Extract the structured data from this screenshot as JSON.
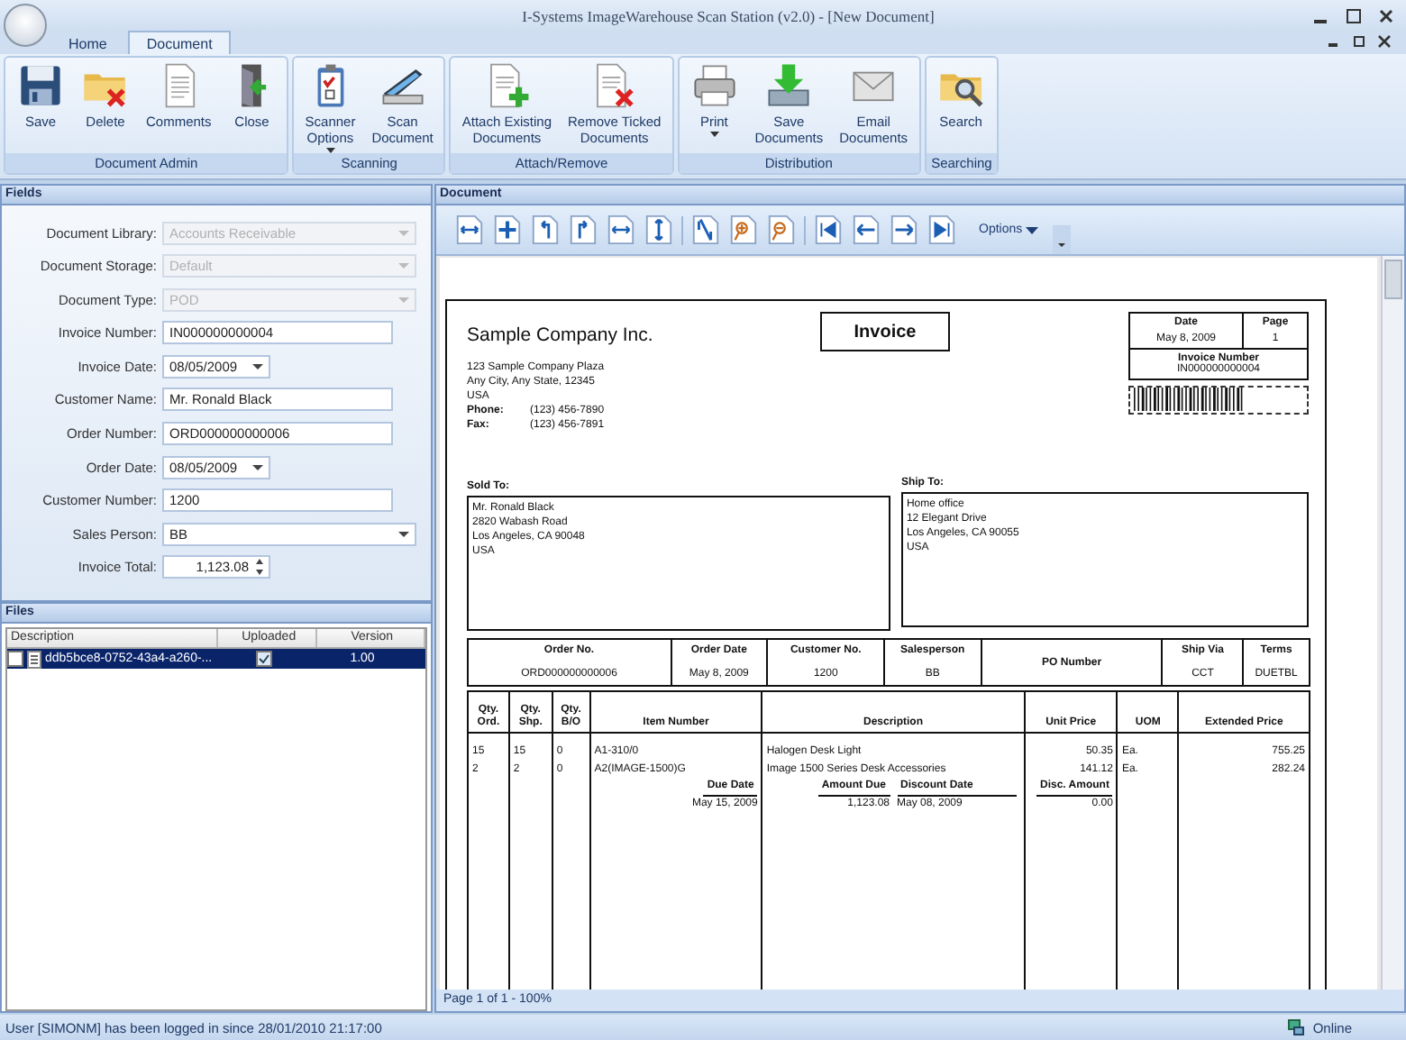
{
  "window": {
    "title": "I-Systems ImageWarehouse Scan Station (v2.0) - [New Document]"
  },
  "tabs": [
    {
      "label": "Home",
      "selected": false
    },
    {
      "label": "Document",
      "selected": true
    }
  ],
  "ribbon": [
    {
      "label": "Document Admin",
      "buttons": [
        {
          "kind": "floppy",
          "lines": [
            "Save"
          ]
        },
        {
          "kind": "folder-x",
          "lines": [
            "Delete"
          ]
        },
        {
          "kind": "page",
          "lines": [
            "Comments"
          ]
        },
        {
          "kind": "door",
          "lines": [
            "Close"
          ]
        }
      ]
    },
    {
      "label": "Scanning",
      "buttons": [
        {
          "kind": "clipboard",
          "lines": [
            "Scanner",
            "Options"
          ],
          "dropdown": true
        },
        {
          "kind": "scanner",
          "lines": [
            "Scan",
            "Document"
          ]
        }
      ]
    },
    {
      "label": "Attach/Remove",
      "buttons": [
        {
          "kind": "page-plus",
          "lines": [
            "Attach Existing",
            "Documents"
          ]
        },
        {
          "kind": "page-x",
          "lines": [
            "Remove Ticked",
            "Documents"
          ]
        }
      ]
    },
    {
      "label": "Distribution",
      "buttons": [
        {
          "kind": "printer",
          "lines": [
            "Print"
          ],
          "dropdown": true
        },
        {
          "kind": "tray",
          "lines": [
            "Save",
            "Documents"
          ]
        },
        {
          "kind": "envelope",
          "lines": [
            "Email",
            "Documents"
          ]
        }
      ]
    },
    {
      "label": "Searching",
      "buttons": [
        {
          "kind": "folder-search",
          "lines": [
            "Search"
          ]
        }
      ]
    }
  ],
  "fields": {
    "title": "Fields",
    "items": [
      {
        "label": "Document Library:",
        "value": "Accounts Receivable",
        "kind": "combo",
        "disabled": true
      },
      {
        "label": "Document Storage:",
        "value": "Default",
        "kind": "combo",
        "disabled": true
      },
      {
        "label": "Document Type:",
        "value": "POD",
        "kind": "combo",
        "disabled": true
      },
      {
        "label": "Invoice Number:",
        "value": "IN000000000004",
        "kind": "text",
        "disabled": false
      },
      {
        "label": "Invoice Date:",
        "value": "08/05/2009",
        "kind": "date",
        "disabled": false
      },
      {
        "label": "Customer Name:",
        "value": "Mr. Ronald Black",
        "kind": "text",
        "disabled": false
      },
      {
        "label": "Order Number:",
        "value": "ORD000000000006",
        "kind": "text",
        "disabled": false
      },
      {
        "label": "Order Date:",
        "value": "08/05/2009",
        "kind": "date",
        "disabled": false
      },
      {
        "label": "Customer Number:",
        "value": "1200",
        "kind": "text",
        "disabled": false
      },
      {
        "label": "Sales Person:",
        "value": "BB",
        "kind": "combo",
        "disabled": false
      },
      {
        "label": "Invoice Total:",
        "value": "1,123.08",
        "kind": "spin",
        "disabled": false
      }
    ]
  },
  "files": {
    "title": "Files",
    "columns": [
      "Description",
      "Uploaded",
      "Version"
    ],
    "rows": [
      {
        "description": "ddb5bce8-0752-43a4-a260-...",
        "uploaded": true,
        "version": "1.00",
        "checked": false,
        "selected": true
      }
    ]
  },
  "document": {
    "title": "Document",
    "options": "Options",
    "page_status": "Page 1 of 1 - 100%",
    "invoice": {
      "company": "Sample Company Inc.",
      "title": "Invoice",
      "address": [
        "123 Sample Company Plaza",
        "Any City, Any State, 12345",
        "USA"
      ],
      "contacts": [
        {
          "label": "Phone:",
          "value": "(123) 456-7890"
        },
        {
          "label": "Fax:",
          "value": "(123) 456-7891"
        }
      ],
      "date_label": "Date",
      "date": "May 8, 2009",
      "page_label": "Page",
      "page": "1",
      "number_label": "Invoice Number",
      "number": "IN000000000004",
      "sold_to_label": "Sold To:",
      "sold_to": [
        "Mr. Ronald Black",
        "2820 Wabash Road",
        "Los Angeles, CA 90048",
        "USA"
      ],
      "ship_to_label": "Ship To:",
      "ship_to": [
        "Home office",
        "12 Elegant Drive",
        "Los Angeles, CA 90055",
        "USA"
      ],
      "order": [
        {
          "label": "Order No.",
          "value": "ORD000000000006"
        },
        {
          "label": "Order Date",
          "value": "May 8, 2009"
        },
        {
          "label": "Customer No.",
          "value": "1200"
        },
        {
          "label": "Salesperson",
          "value": "BB"
        },
        {
          "label": "PO Number"
        },
        {
          "label": "Ship Via",
          "value": "CCT"
        },
        {
          "label": "Terms",
          "value": "DUETBL"
        }
      ],
      "item_columns": [
        "Qty.\nOrd.",
        "Qty.\nShp.",
        "Qty.\nB/O",
        "Item Number",
        "Description",
        "Unit Price",
        "UOM",
        "Extended Price"
      ],
      "items": [
        [
          "15",
          "15",
          "0",
          "A1-310/0",
          "Halogen Desk Light",
          "50.35",
          "Ea.",
          "755.25"
        ],
        [
          "2",
          "2",
          "0",
          "A2(IMAGE-1500)G",
          "Image 1500 Series Desk Accessories",
          "141.12",
          "Ea.",
          "282.24"
        ]
      ],
      "due_date_label": "Due Date",
      "due_date": "May 15, 2009",
      "amount_due_label": "Amount Due",
      "amount_due": "1,123.08",
      "discount_date_label": "Discount Date",
      "discount_date": "May 08, 2009",
      "disc_amount_label": "Disc. Amount",
      "disc_amount": "0.00"
    }
  },
  "status_bar": {
    "message": "User [SIMONM] has been logged in since 28/01/2010 21:17:00",
    "connection": "Online"
  }
}
